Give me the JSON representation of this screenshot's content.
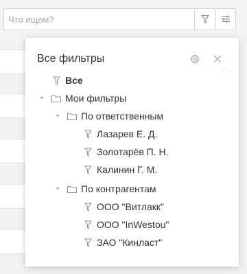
{
  "search": {
    "placeholder": "Что ищем?"
  },
  "filters_panel": {
    "title": "Все фильтры",
    "all_label": "Все",
    "my_filters": {
      "label": "Мои фильтры",
      "groups": [
        {
          "label": "По ответственным",
          "items": [
            "Лазарев Е. Д.",
            "Золотарёв П. Н.",
            "Калинин Г. М."
          ]
        },
        {
          "label": "По контрагентам",
          "items": [
            "ООО \"Витлакк\"",
            "ООО \"InWestou\"",
            "ЗАО \"Кинласт\""
          ]
        }
      ]
    }
  },
  "colors": {
    "icon": "#9a9a9a",
    "text": "#333333",
    "border": "#d5d5d5"
  }
}
